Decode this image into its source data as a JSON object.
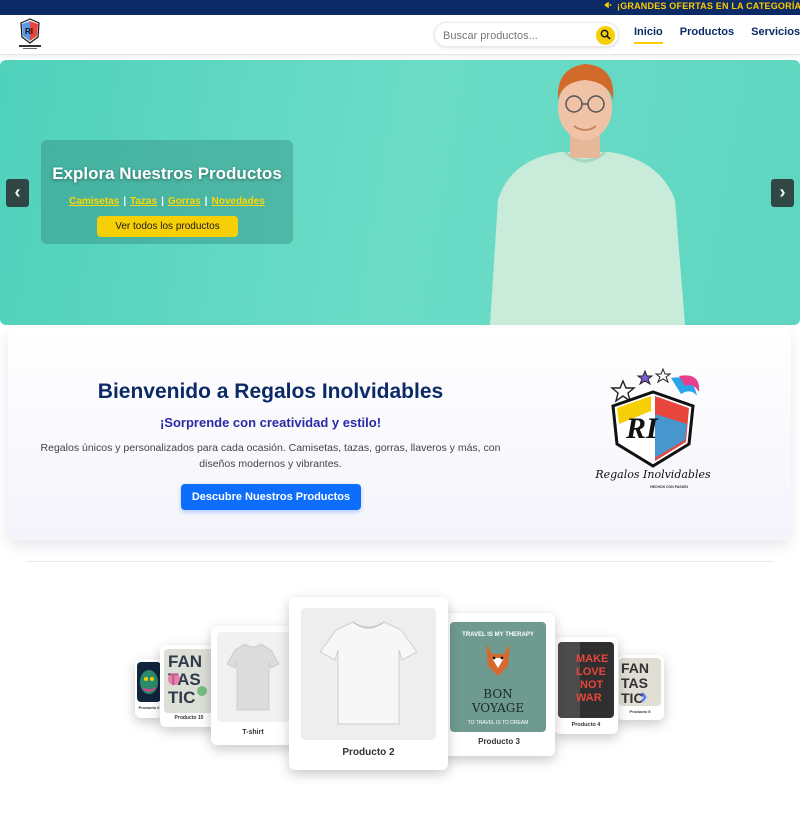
{
  "ticker": {
    "text": "¡GRANDES OFERTAS EN LA CATEGORÍA DE"
  },
  "header": {
    "logo_alt": "Regalos Inolvidables",
    "search_placeholder": "Buscar productos...",
    "nav": [
      "Inicio",
      "Productos",
      "Servicios"
    ]
  },
  "hero": {
    "title": "Explora Nuestros Productos",
    "links": [
      "Camisetas",
      "Tazas",
      "Gorras",
      "Novedades"
    ],
    "button": "Ver todos los productos",
    "prev": "‹",
    "next": "›"
  },
  "welcome": {
    "title": "Bienvenido a Regalos Inolvidables",
    "subtitle": "¡Sorprende con creatividad y estilo!",
    "description": "Regalos únicos y personalizados para cada ocasión. Camisetas, tazas, gorras, llaveros y más, con diseños modernos y vibrantes.",
    "button": "Descubre Nuestros Productos",
    "logo_text": "Regalos Inolvidables",
    "logo_tag": "HECHOS CON PASIÓN",
    "logo_initials": "RI"
  },
  "carousel": {
    "products": [
      "Producto 2",
      "T-shirt",
      "Producto 3",
      "Producto 10",
      "Producto 4",
      "Producto 6",
      "Producto 5"
    ],
    "poster_fan": [
      "FAN",
      "TAS",
      "TIC"
    ],
    "poster_voyage": [
      "BON",
      "VOYAGE"
    ],
    "poster_voyage_top": "TRAVEL IS MY THERAPY",
    "poster_voyage_bottom": "TO TRAVEL IS TO DREAM",
    "poster_love": [
      "MAKE",
      "LOVE",
      "NOT",
      "WAR"
    ],
    "chevron": "›"
  }
}
